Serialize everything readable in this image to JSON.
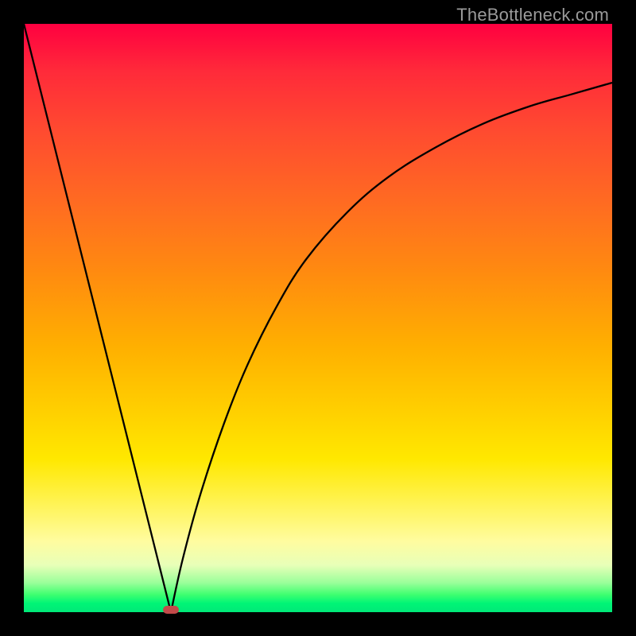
{
  "watermark": "TheBottleneck.com",
  "colors": {
    "frame": "#000000",
    "curve": "#000000",
    "minimum_marker": "#c24a4a",
    "gradient_top": "#ff0040",
    "gradient_bottom": "#00e878"
  },
  "chart_data": {
    "type": "line",
    "title": "",
    "xlabel": "",
    "ylabel": "",
    "xlim": [
      0,
      100
    ],
    "ylim": [
      0,
      100
    ],
    "series": [
      {
        "name": "left-branch",
        "x": [
          0,
          4,
          8,
          12,
          16,
          20,
          23,
          25
        ],
        "values": [
          100,
          84,
          68,
          52,
          36,
          20,
          8,
          0
        ]
      },
      {
        "name": "right-branch",
        "x": [
          25,
          27,
          30,
          34,
          38,
          43,
          48,
          55,
          62,
          70,
          78,
          86,
          93,
          100
        ],
        "values": [
          0,
          9,
          20,
          32,
          42,
          52,
          60,
          68,
          74,
          79,
          83,
          86,
          88,
          90
        ]
      }
    ],
    "annotations": [
      {
        "name": "minimum",
        "x": 25,
        "y": 0
      }
    ],
    "gradient_meaning": "vertical color scale from red (high / bad) at top to green (low / good) at bottom"
  }
}
